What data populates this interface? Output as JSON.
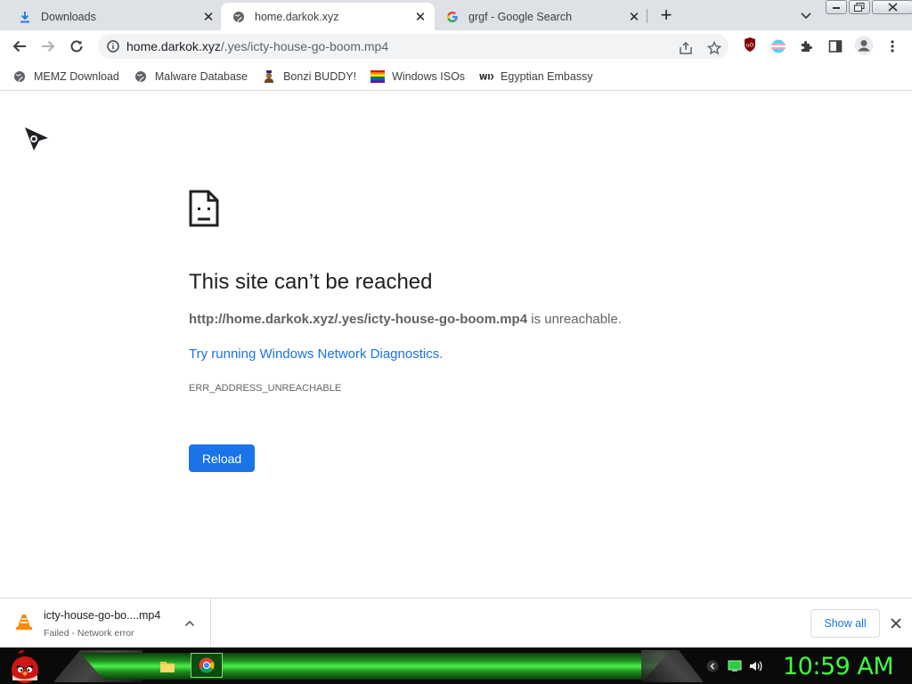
{
  "tabs": [
    {
      "title": "Downloads",
      "icon": "download-icon",
      "active": false
    },
    {
      "title": "home.darkok.xyz",
      "icon": "globe-icon",
      "active": true
    },
    {
      "title": "grgf - Google Search",
      "icon": "google-icon",
      "active": false
    }
  ],
  "toolbar": {
    "url_host": "home.darkok.xyz",
    "url_path": "/.yes/icty-house-go-boom.mp4"
  },
  "bookmarks": [
    {
      "label": "MEMZ Download",
      "icon": "globe-icon"
    },
    {
      "label": "Malware Database",
      "icon": "globe-icon"
    },
    {
      "label": "Bonzi BUDDY!",
      "icon": "bonzi-icon"
    },
    {
      "label": "Windows ISOs",
      "icon": "rainbow-flag-icon"
    },
    {
      "label": "Egyptian Embassy",
      "icon": "wix-icon"
    }
  ],
  "error": {
    "title": "This site can’t be reached",
    "url": "http://home.darkok.xyz/.yes/icty-house-go-boom.mp4",
    "unreachable_suffix": " is unreachable.",
    "suggestion": "Try running Windows Network Diagnostics.",
    "code": "ERR_ADDRESS_UNREACHABLE",
    "reload_label": "Reload"
  },
  "download": {
    "filename": "icty-house-go-bo....mp4",
    "status": "Failed - Network error",
    "icon": "vlc-cone-icon",
    "show_all_label": "Show all"
  },
  "taskbar": {
    "clock": "10:59 AM",
    "start_icon": "angry-bird-icon",
    "apps": [
      "folder-icon",
      "chrome-icon"
    ],
    "accent": "#3dff3d"
  },
  "colors": {
    "tabstrip": "#dee1e6",
    "link_blue": "#1a73e8",
    "button_blue": "#1a73e8"
  }
}
